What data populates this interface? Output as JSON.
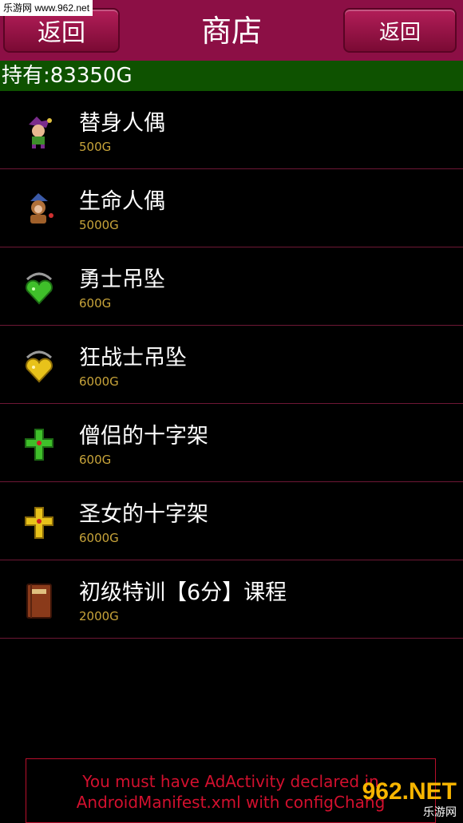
{
  "watermark_top": "乐游网 www.962.net",
  "header": {
    "back_left_label": "返回",
    "title": "商店",
    "back_right_label": "返回",
    "bg_color": "#8c0f45"
  },
  "gold": {
    "label": "持有:83350G"
  },
  "items": [
    {
      "name": "替身人偶",
      "price": "500G",
      "icon": "jester-doll-icon"
    },
    {
      "name": "生命人偶",
      "price": "5000G",
      "icon": "monkey-doll-icon"
    },
    {
      "name": "勇士吊坠",
      "price": "600G",
      "icon": "green-heart-pendant-icon"
    },
    {
      "name": "狂战士吊坠",
      "price": "6000G",
      "icon": "gold-heart-pendant-icon"
    },
    {
      "name": "僧侣的十字架",
      "price": "600G",
      "icon": "green-cross-icon"
    },
    {
      "name": "圣女的十字架",
      "price": "6000G",
      "icon": "gold-cross-icon"
    },
    {
      "name": "初级特训【6分】课程",
      "price": "2000G",
      "icon": "book-icon"
    }
  ],
  "ad": {
    "line1": "You must have AdActivity declared in",
    "line2": "AndroidManifest.xml with configChang"
  },
  "watermark_br": {
    "big": "962.NET",
    "small": "乐游网"
  }
}
